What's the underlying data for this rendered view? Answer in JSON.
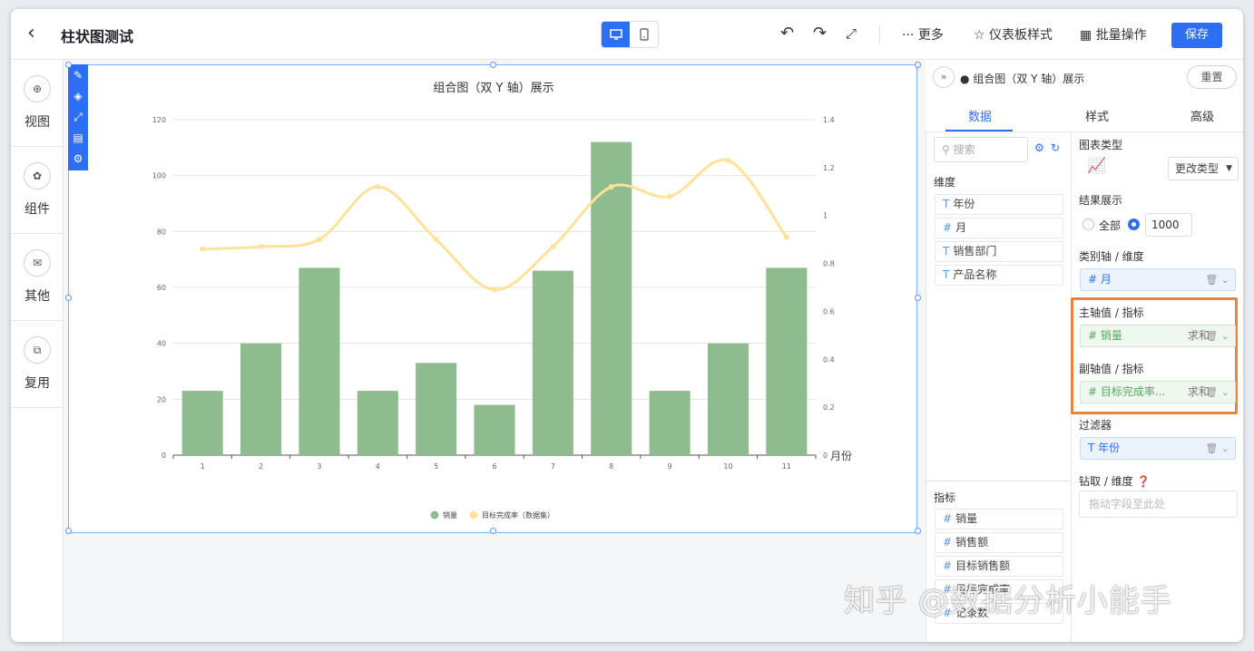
{
  "header": {
    "back_icon": "chevron-left-icon",
    "title": "柱状图测试",
    "more": "··· 更多",
    "dashboard_style": "仪表板样式",
    "batch": "批量操作",
    "save": "保存"
  },
  "sidebar": {
    "items": [
      {
        "label": "视图",
        "icon": "plus-circle-icon"
      },
      {
        "label": "组件",
        "icon": "component-icon"
      },
      {
        "label": "其他",
        "icon": "chat-icon"
      },
      {
        "label": "复用",
        "icon": "copy-icon"
      }
    ]
  },
  "panel": {
    "title": "组合图（双 Y 轴）展示",
    "reset": "重置",
    "tabs": [
      "数据",
      "样式",
      "高级"
    ]
  },
  "fields": {
    "search_placeholder": "搜索",
    "dimension_label": "维度",
    "dimensions": [
      {
        "type": "T",
        "name": "年份"
      },
      {
        "type": "#",
        "name": "月"
      },
      {
        "type": "T",
        "name": "销售部门"
      },
      {
        "type": "T",
        "name": "产品名称"
      }
    ],
    "measure_label": "指标",
    "measures": [
      {
        "type": "#",
        "name": "销量"
      },
      {
        "type": "#",
        "name": "销售额"
      },
      {
        "type": "#",
        "name": "目标销售额"
      },
      {
        "type": "#",
        "name": "目标完成率"
      },
      {
        "type": "#",
        "name": "记录数"
      }
    ]
  },
  "config": {
    "chart_type_label": "图表类型",
    "change_type": "更改类型",
    "result_label": "结果展示",
    "all": "全部",
    "limit": "1000",
    "category_label": "类别轴 / 维度",
    "category_field": "# 月",
    "primary_label": "主轴值 / 指标",
    "primary_field": "# 销量",
    "primary_agg": "求和",
    "secondary_label": "副轴值 / 指标",
    "secondary_field": "# 目标完成率...",
    "secondary_agg": "求和",
    "filter_label": "过滤器",
    "filter_field": "T 年份",
    "drill_label": "钻取 / 维度",
    "drill_placeholder": "拖动字段至此处"
  },
  "watermark": "知乎 @数据分析小能手",
  "chart_data": {
    "type": "bar",
    "title": "组合图（双 Y 轴）展示",
    "categories": [
      "1",
      "2",
      "3",
      "4",
      "5",
      "6",
      "7",
      "8",
      "9",
      "10",
      "11"
    ],
    "series": [
      {
        "name": "销量",
        "type": "bar",
        "axis": "left",
        "color": "#8fbc8f",
        "values": [
          23,
          40,
          67,
          23,
          33,
          18,
          66,
          112,
          23,
          40,
          67
        ]
      },
      {
        "name": "目标完成率（数据集）",
        "type": "line",
        "axis": "right",
        "color": "#fde29a",
        "values": [
          0.86,
          0.87,
          0.9,
          1.12,
          0.9,
          0.69,
          0.87,
          1.12,
          1.08,
          1.23,
          0.91
        ]
      }
    ],
    "left_axis": {
      "min": 0,
      "max": 120,
      "ticks": [
        0,
        20,
        40,
        60,
        80,
        100,
        120
      ]
    },
    "right_axis": {
      "min": 0,
      "max": 1.4,
      "ticks": [
        "0",
        "0.2",
        "0.4",
        "0.6",
        "0.8",
        "1",
        "1.2",
        "1.4"
      ]
    },
    "xlabel": "月份",
    "legend": "bottom-center",
    "grid": true
  }
}
